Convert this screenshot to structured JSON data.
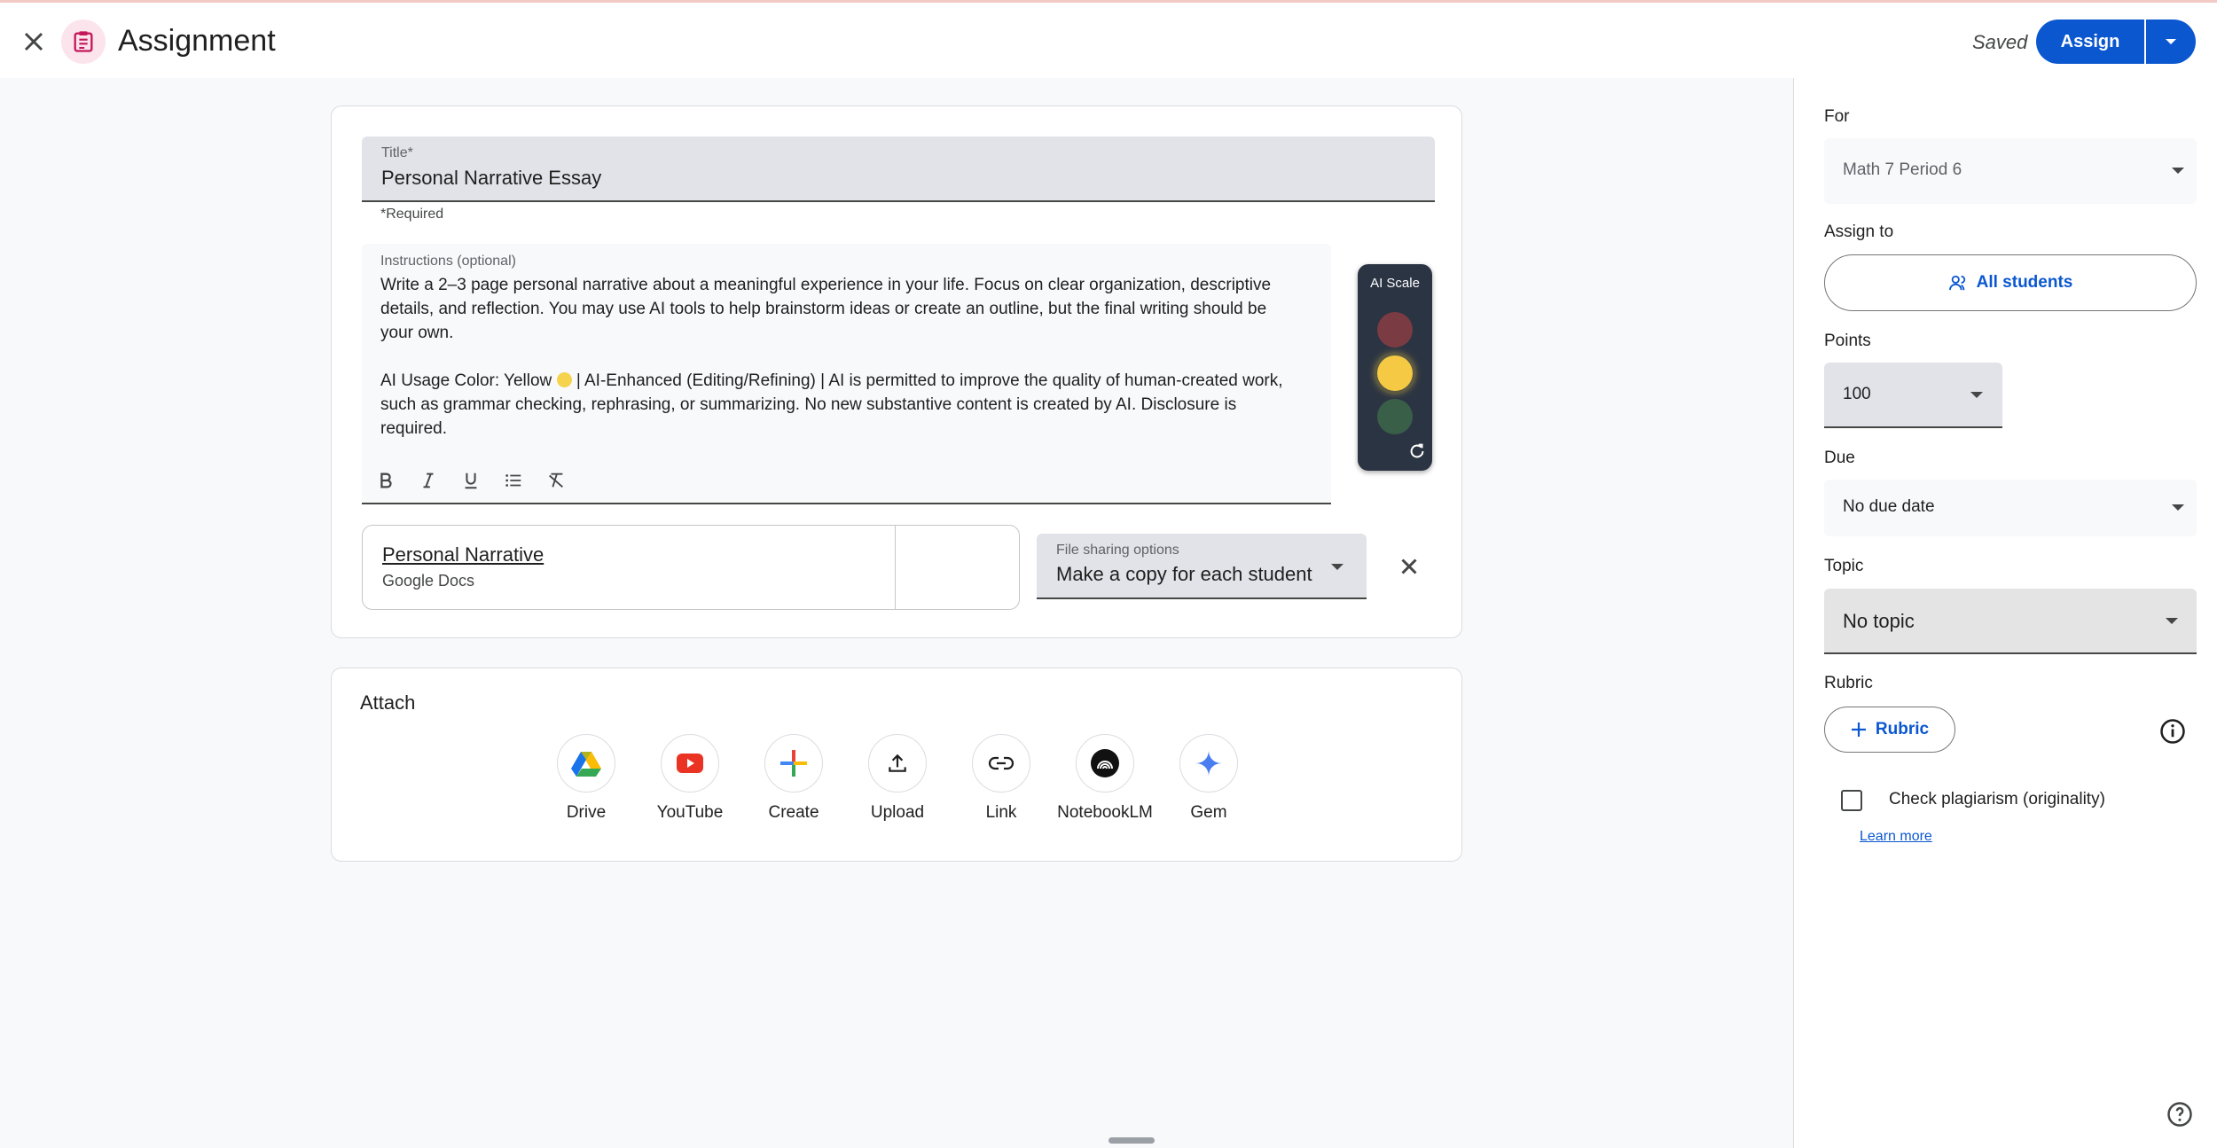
{
  "header": {
    "title": "Assignment",
    "saved_label": "Saved",
    "assign_label": "Assign"
  },
  "main": {
    "title_label": "Title*",
    "title_value": "Personal Narrative Essay",
    "required_note": "*Required",
    "instructions_label": "Instructions (optional)",
    "instructions_p1": "Write a 2–3 page personal narrative about a meaningful experience in your life. Focus on clear organization, descriptive details, and reflection. You may use AI tools to help brainstorm ideas or create an outline, but the final writing should be your own.",
    "instructions_p2_prefix": "AI Usage Color: Yellow",
    "instructions_p2_suffix": "| AI-Enhanced (Editing/Refining) | AI is permitted to improve the quality of human-created work, such as grammar checking, rephrasing, or summarizing. No new substantive content is created by AI. Disclosure is required.",
    "ai_scale_label": "AI Scale",
    "ai_scale_selected": "yellow",
    "attachment": {
      "title": "Personal Narrative",
      "type": "Google Docs"
    },
    "file_sharing": {
      "label": "File sharing options",
      "value": "Make a copy for each student"
    }
  },
  "attach": {
    "title": "Attach",
    "items": [
      {
        "label": "Drive",
        "icon": "drive-icon"
      },
      {
        "label": "YouTube",
        "icon": "youtube-icon"
      },
      {
        "label": "Create",
        "icon": "create-icon"
      },
      {
        "label": "Upload",
        "icon": "upload-icon"
      },
      {
        "label": "Link",
        "icon": "link-icon"
      },
      {
        "label": "NotebookLM",
        "icon": "notebooklm-icon"
      },
      {
        "label": "Gem",
        "icon": "gem-icon"
      }
    ]
  },
  "sidebar": {
    "for_label": "For",
    "for_value": "Math 7 Period 6",
    "assign_to_label": "Assign to",
    "assign_to_value": "All students",
    "points_label": "Points",
    "points_value": "100",
    "due_label": "Due",
    "due_value": "No due date",
    "topic_label": "Topic",
    "topic_value": "No topic",
    "rubric_label": "Rubric",
    "rubric_button": "Rubric",
    "plagiarism_label": "Check plagiarism (originality)",
    "learn_more": "Learn more"
  },
  "colors": {
    "accent": "#0b57d0",
    "ai_yellow": "#f6c945"
  }
}
